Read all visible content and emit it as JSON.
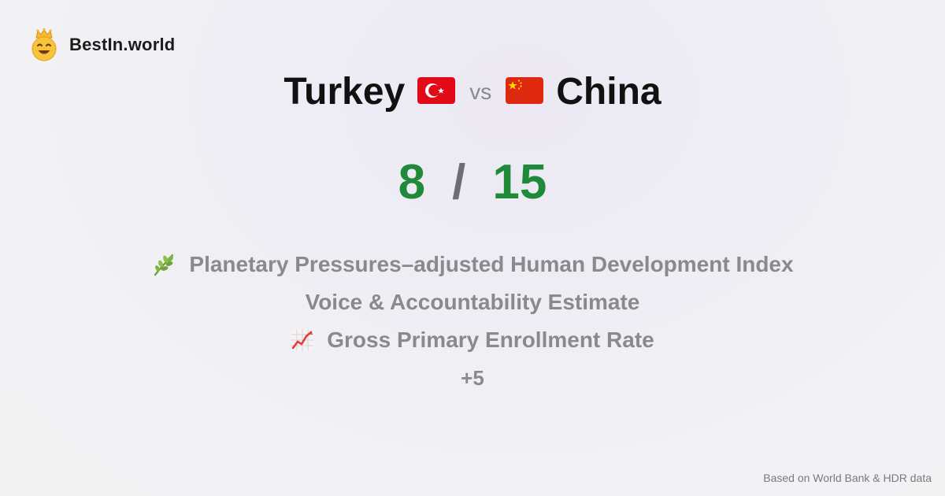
{
  "brand": {
    "name": "BestIn.world",
    "icon": "crowned-smiley-logo"
  },
  "comparison": {
    "left_country": "Turkey",
    "left_flag": "turkey-flag-icon",
    "vs_label": "vs",
    "right_country": "China",
    "right_flag": "china-flag-icon",
    "left_score": "8",
    "separator": "/",
    "right_score": "15"
  },
  "metrics": [
    {
      "label": "Planetary Pressures–adjusted Human Development Index",
      "icon": "herb-icon"
    },
    {
      "label": "Voice & Accountability Estimate",
      "icon": ""
    },
    {
      "label": "Gross Primary Enrollment Rate",
      "icon": "chart-increasing-icon"
    }
  ],
  "more_label": "+5",
  "footer": {
    "source": "Based on World Bank & HDR data"
  },
  "colors": {
    "score_green": "#1f8a3a",
    "muted_text": "#8a8a8c",
    "turkey_red": "#e30a17",
    "china_red": "#de2910",
    "china_star": "#ffde00"
  }
}
